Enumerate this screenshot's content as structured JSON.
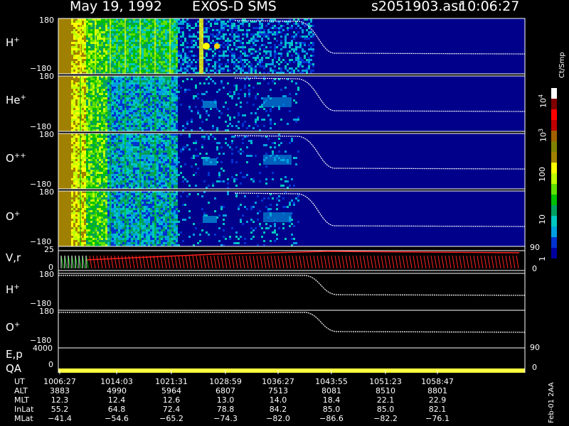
{
  "title": {
    "date": "May 19, 1992",
    "instrument": "EXOS-D SMS",
    "file": "s2051903.asr",
    "time": "10:06:27"
  },
  "colorbar": {
    "unit_label": "Ct/Smp",
    "labels": [
      "10",
      "10",
      "100",
      "10",
      "1"
    ],
    "label_sups": [
      "4",
      "3",
      "",
      "",
      ""
    ],
    "colors": [
      "#0000a0",
      "#0033d0",
      "#00a0e0",
      "#00c8c0",
      "#00a060",
      "#00c000",
      "#60e000",
      "#c0ff00",
      "#ffff00",
      "#a08000",
      "#808000",
      "#a06000",
      "#c00000",
      "#ff0000",
      "#800000",
      "#ffffff"
    ]
  },
  "panel_labels": {
    "h_plus": {
      "base": "H",
      "sup": "+"
    },
    "he_plus": {
      "base": "He",
      "sup": "+"
    },
    "o_pp": {
      "base": "O",
      "sup": "++"
    },
    "o_plus": {
      "base": "O",
      "sup": "+"
    },
    "vr": "V,r",
    "h_plus2": {
      "base": "H",
      "sup": "+"
    },
    "o_plus2": {
      "base": "O",
      "sup": "+"
    },
    "ep": "E,p",
    "qa": "QA"
  },
  "axis_ticks": {
    "spec_top": "180",
    "spec_bottom": "−180",
    "vr_top": "25",
    "vr_bottom": "0",
    "vr_right_top": "90",
    "vr_right_bottom": "0",
    "line_top": "180",
    "line_bottom": "−180",
    "ep_left": "4000",
    "ep_right": "90",
    "qa_left": "0",
    "qa_right": "0"
  },
  "footer_date": "Feb-01 2AA",
  "table": {
    "row_labels": [
      "UT",
      "ALT",
      "MLT",
      "InLat",
      "MLat"
    ],
    "columns": [
      [
        "1006:27",
        "3883",
        "12.3",
        "55.2",
        "−41.4"
      ],
      [
        "1014:03",
        "4990",
        "12.4",
        "64.8",
        "−54.6"
      ],
      [
        "1021:31",
        "5964",
        "12.6",
        "72.4",
        "−65.2"
      ],
      [
        "1028:59",
        "6807",
        "13.0",
        "78.8",
        "−74.3"
      ],
      [
        "1036:27",
        "7513",
        "14.0",
        "84.2",
        "−82.0"
      ],
      [
        "1043:55",
        "8081",
        "18.4",
        "85.0",
        "−86.6"
      ],
      [
        "1051:23",
        "8510",
        "22.1",
        "85.0",
        "−82.2"
      ],
      [
        "1058:47",
        "8801",
        "22.9",
        "82.1",
        "−76.1"
      ]
    ]
  },
  "chart_data": {
    "type": "heatmap",
    "title": "May 19, 1992   EXOS-D SMS   s2051903.asr  10:06:27",
    "x": [
      "1006:27",
      "1014:03",
      "1021:31",
      "1028:59",
      "1036:27",
      "1043:55",
      "1051:23",
      "1058:47"
    ],
    "xlabel": "UT",
    "panels": [
      {
        "name": "H+",
        "type": "spectrogram",
        "ylim": [
          -180,
          180
        ]
      },
      {
        "name": "He+",
        "type": "spectrogram",
        "ylim": [
          -180,
          180
        ]
      },
      {
        "name": "O++",
        "type": "spectrogram",
        "ylim": [
          -180,
          180
        ]
      },
      {
        "name": "O+",
        "type": "spectrogram",
        "ylim": [
          -180,
          180
        ]
      },
      {
        "name": "V,r",
        "type": "line",
        "ylim": [
          0,
          25
        ],
        "right_ylim": [
          0,
          90
        ]
      },
      {
        "name": "H+",
        "type": "line",
        "ylim": [
          -180,
          180
        ]
      },
      {
        "name": "O+",
        "type": "line",
        "ylim": [
          -180,
          180
        ]
      },
      {
        "name": "E,p",
        "type": "line",
        "left_tick": 4000,
        "right_tick": 90
      },
      {
        "name": "QA",
        "type": "bar",
        "left_tick": 0,
        "right_tick": 0
      }
    ],
    "colorbar": {
      "label": "Ct/Smp",
      "ticks": [
        "1",
        "10",
        "100",
        "10^3",
        "10^4"
      ],
      "scale": "log"
    }
  }
}
